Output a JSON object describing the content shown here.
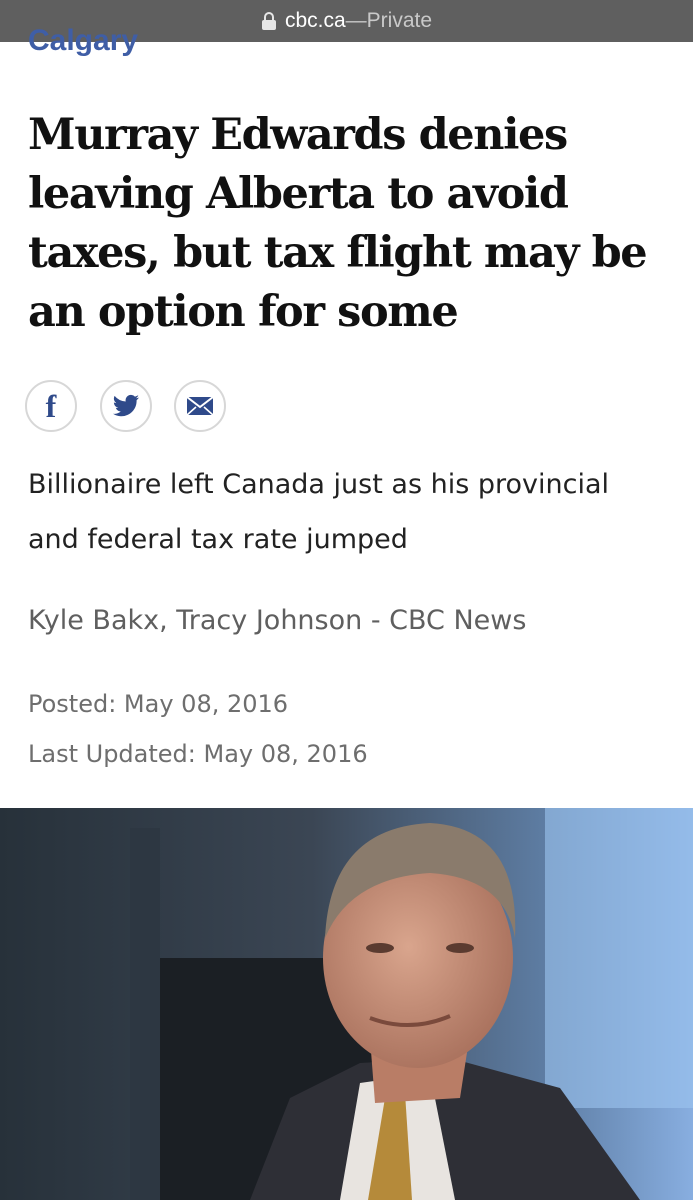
{
  "browser": {
    "domain": "cbc.ca",
    "separator": " — ",
    "mode": "Private",
    "lock_icon": "lock-icon"
  },
  "article": {
    "section": "Calgary",
    "headline": "Murray Edwards denies leaving Alberta to avoid taxes, but tax flight may be an option for some",
    "share_icons": [
      "facebook-icon",
      "twitter-icon",
      "email-icon"
    ],
    "dek": "Billionaire left Canada just as his provincial and federal tax rate jumped",
    "byline": "Kyle Bakx, Tracy Johnson - CBC News",
    "posted": "Posted: May 08, 2016",
    "updated": "Last Updated: May 08, 2016"
  },
  "colors": {
    "section": "#3f5ea6",
    "share_icon": "#2f4a8a",
    "urlbar": "#5f5f5f"
  }
}
